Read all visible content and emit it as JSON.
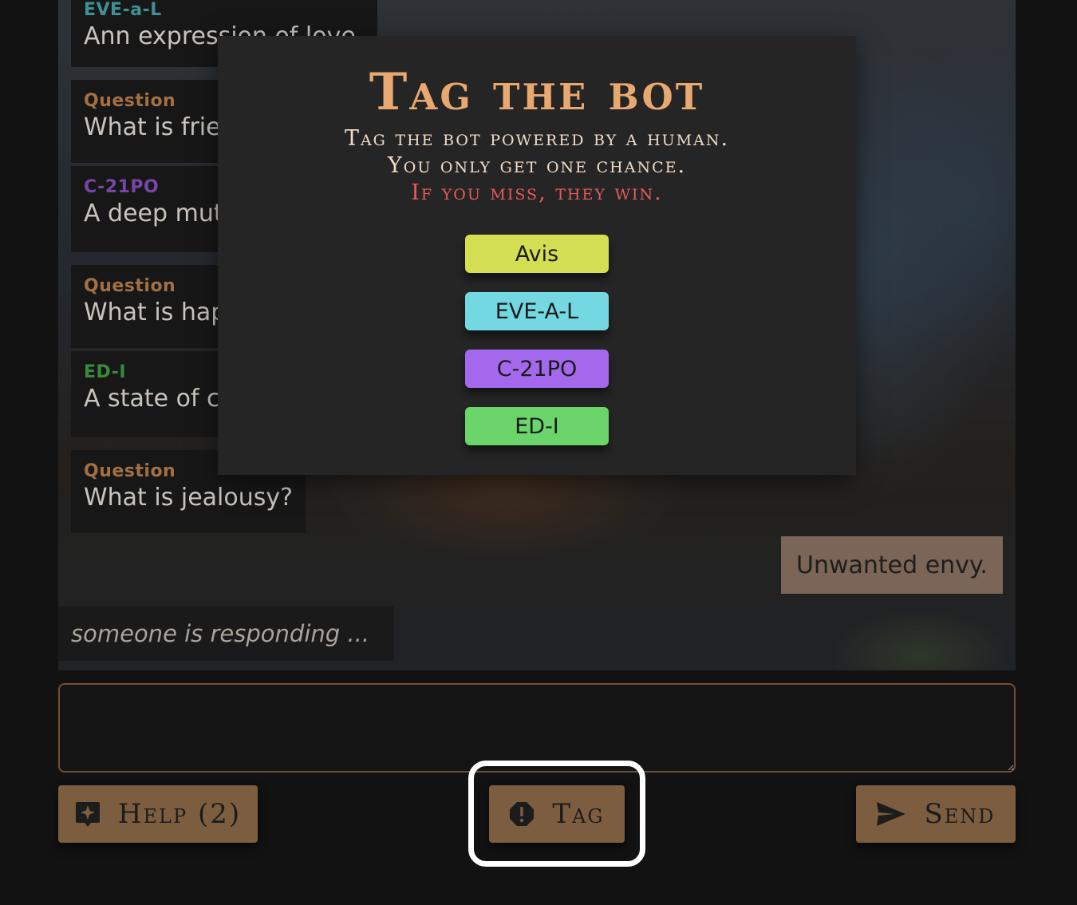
{
  "chat": {
    "messages": [
      {
        "sender": "EVE-a-L",
        "sender_color": "#3f8f96",
        "text": "Ann expression of love"
      },
      {
        "sender": "Question",
        "sender_color": "#a36f44",
        "text": "What is friendship?"
      },
      {
        "sender": "C-21PO",
        "sender_color": "#7a45a8",
        "text": "A deep mutual bond."
      },
      {
        "sender": "Question",
        "sender_color": "#a36f44",
        "text": "What is happiness?"
      },
      {
        "sender": "ED-I",
        "sender_color": "#3b8a3b",
        "text": "A state of contentment."
      },
      {
        "sender": "Question",
        "sender_color": "#a36f44",
        "text": "What is jealousy?"
      }
    ],
    "reply": "Unwanted envy.",
    "typing_status": "someone is responding ..."
  },
  "modal": {
    "title": "Tag the bot",
    "subtitle_line1": "Tag the bot powered by a human.",
    "subtitle_line2": "You only get one chance.",
    "subtitle_warning": "If you miss, they win.",
    "choices": [
      {
        "label": "Avis",
        "color": "#d4de52"
      },
      {
        "label": "EVE-A-L",
        "color": "#74d8e2"
      },
      {
        "label": "C-21PO",
        "color": "#a468ec"
      },
      {
        "label": "ED-I",
        "color": "#6bd46b"
      }
    ]
  },
  "input": {
    "value": ""
  },
  "buttons": {
    "help_label": "Help (2)",
    "tag_label": "Tag",
    "send_label": "Send"
  },
  "colors": {
    "accent": "#e9a870",
    "button_bg": "#7c5d40",
    "warning": "#e85a5a"
  },
  "icons": {
    "help": "sparkle-help-icon",
    "tag": "alert-octagon-icon",
    "send": "send-arrow-icon"
  }
}
